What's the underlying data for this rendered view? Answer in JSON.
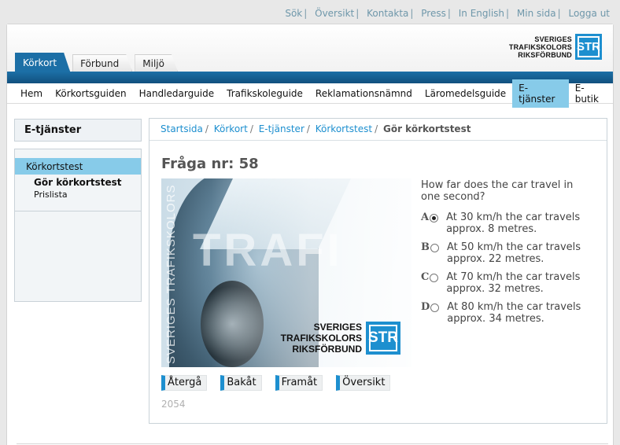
{
  "toplinks": [
    "Sök",
    "Översikt",
    "Kontakta",
    "Press",
    "In English",
    "Min sida",
    "Logga ut"
  ],
  "logo": {
    "line1": "SVERIGES",
    "line2": "TRAFIKSKOLORS",
    "line3": "RIKSFÖRBUND",
    "mark": "STR"
  },
  "tabs": [
    "Körkort",
    "Förbund",
    "Miljö"
  ],
  "nav": [
    "Hem",
    "Körkortsguiden",
    "Handledarguide",
    "Trafikskoleguide",
    "Reklamationsnämnd",
    "Läromedelsguide",
    "E-tjänster",
    "E-butik"
  ],
  "sidebar": {
    "title": "E-tjänster",
    "section": "Körkortstest",
    "sub1": "Gör körkortstest",
    "sub2": "Prislista"
  },
  "breadcrumb": {
    "items": [
      "Startsida",
      "Körkort",
      "E-tjänster",
      "Körkortstest"
    ],
    "current": "Gör körkortstest"
  },
  "question": {
    "title": "Fråga nr: 58",
    "text": "How far does the car travel in one second?",
    "options": [
      {
        "letter": "A",
        "text": "At 30 km/h the car travels approx. 8 metres.",
        "selected": true
      },
      {
        "letter": "B",
        "text": "At 50 km/h the car travels approx. 22 metres.",
        "selected": false
      },
      {
        "letter": "C",
        "text": "At 70 km/h the car travels approx. 32 metres.",
        "selected": false
      },
      {
        "letter": "D",
        "text": "At 80 km/h the car travels approx. 34 metres.",
        "selected": false
      }
    ]
  },
  "image": {
    "vertical_text": "SVERIGES TRAFIKSKOLORS",
    "big_text": "TRAFI",
    "logo1": "SVERIGES",
    "logo2": "TRAFIKSKOLORS",
    "logo3": "RIKSFÖRBUND",
    "mark": "STR"
  },
  "buttons": [
    "Återgå",
    "Bakåt",
    "Framåt",
    "Översikt"
  ],
  "code": "2054",
  "colors": {
    "accent": "#1d8fcf",
    "bar": "#1c6fa6",
    "highlight": "#87cbe9"
  }
}
